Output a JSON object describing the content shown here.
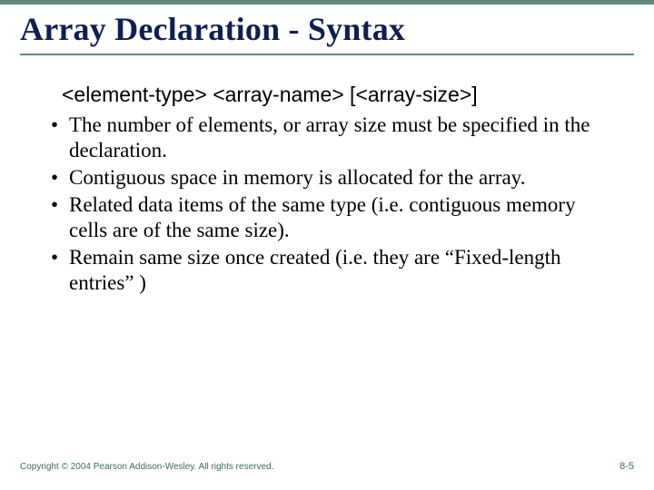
{
  "slide": {
    "title": "Array Declaration - Syntax",
    "syntax": "<element-type> <array-name> [<array-size>]",
    "bullets": [
      "The number of elements, or array size must be specified in the declaration.",
      "Contiguous space in memory is allocated for the array.",
      "Related data items of the same type (i.e. contiguous memory cells are of the same size).",
      "Remain same size once created (i.e. they are “Fixed-length entries” )"
    ],
    "copyright": "Copyright © 2004 Pearson Addison-Wesley. All rights reserved.",
    "page_number": "8-5"
  }
}
